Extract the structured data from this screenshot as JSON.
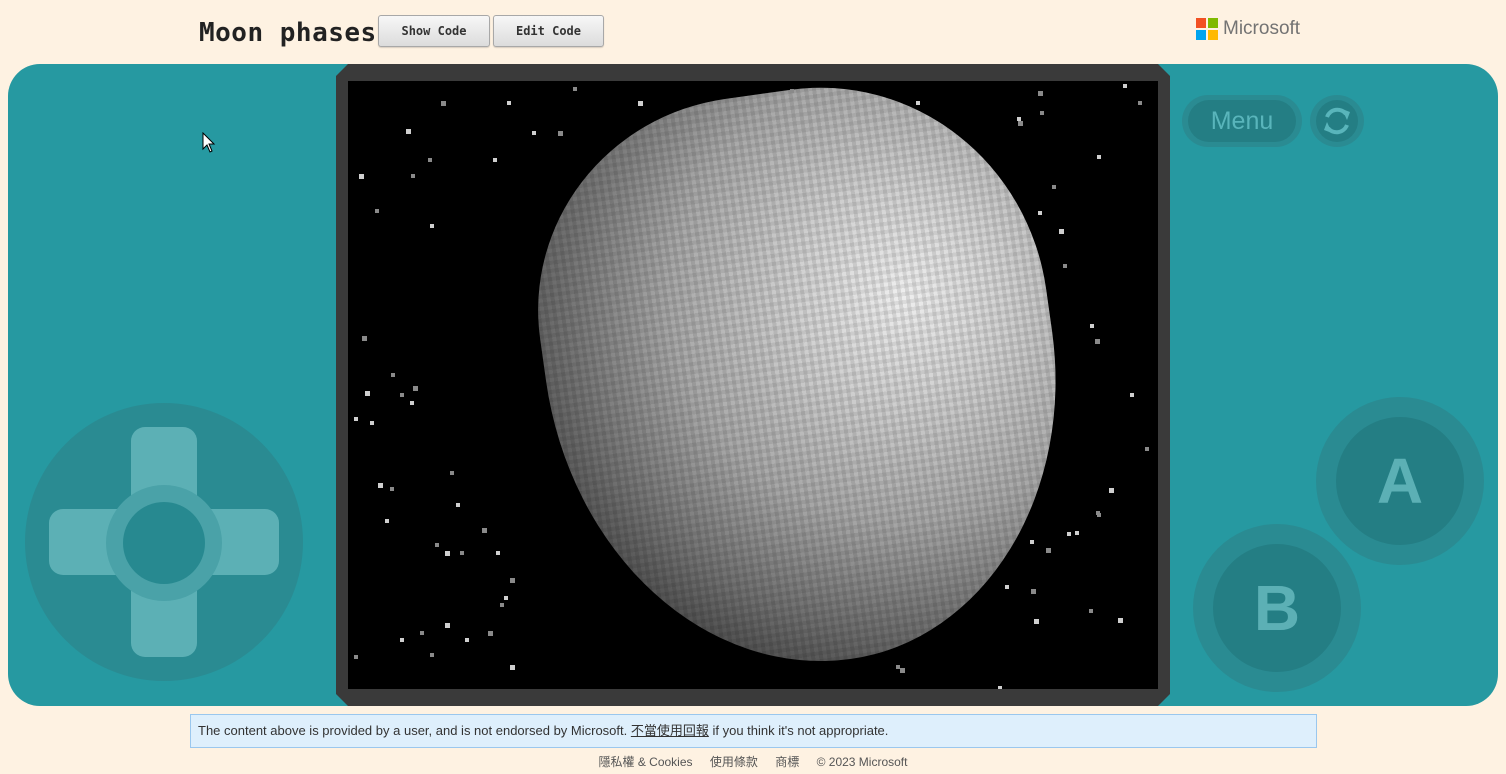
{
  "header": {
    "title": "Moon phases",
    "show_code_label": "Show Code",
    "edit_code_label": "Edit Code",
    "brand": "Microsoft",
    "brand_colors": [
      "#f25022",
      "#7fba00",
      "#00a4ef",
      "#ffb900"
    ]
  },
  "console": {
    "menu_label": "Menu",
    "refresh_icon": "refresh-icon",
    "a_label": "A",
    "b_label": "B",
    "accent_color": "#2699a1"
  },
  "game": {
    "scene": "moon-phase",
    "background": "#000000"
  },
  "notice": {
    "text_before": "The content above is provided by a user, and is not endorsed by Microsoft. ",
    "link_label": "不當使用回報",
    "text_after": " if you think it's not appropriate."
  },
  "footer": {
    "privacy": "隱私權 & Cookies",
    "terms": "使用條款",
    "trademarks": "商標",
    "copyright": "© 2023 Microsoft"
  }
}
